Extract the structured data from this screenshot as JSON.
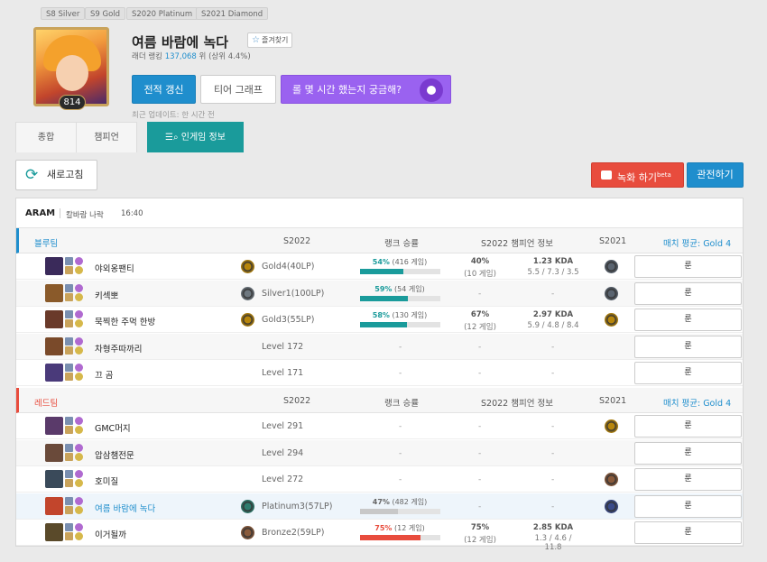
{
  "badges": [
    "S8 Silver",
    "S9 Gold",
    "S2020 Platinum",
    "S2021 Diamond"
  ],
  "profile": {
    "name": "여름 바람에 녹다",
    "favorite": "즐겨찾기",
    "level": "814",
    "ladder_prefix": "래더 랭킹",
    "ladder_rank": "137,068",
    "ladder_suffix": "위 (상위 4.4%)",
    "updated": "최근 업데이트: 한 시간 전"
  },
  "actions": {
    "refresh_record": "전적 갱신",
    "tier_graph": "티어 그래프",
    "promo": "롤 몇 시간 했는지 궁금해?"
  },
  "tabs": [
    "종합",
    "챔피언",
    "인게임 정보"
  ],
  "live": {
    "refresh": "새로고침",
    "record": "녹화 하기",
    "record_sup": "beta",
    "spectate": "관전하기",
    "mode": "ARAM",
    "map": "칼바람 나락",
    "duration": "16:40"
  },
  "columns": {
    "season": "S2022",
    "ranked_wr": "랭크 승률",
    "champ_info": "S2022 챔피언 정보",
    "s2021": "S2021"
  },
  "blue_team": {
    "name": "블루팀",
    "avg": "매치 평균: Gold 4",
    "players": [
      {
        "name": "야외옹팬티",
        "tier": "Gold4(40LP)",
        "tier_color": "#b8860b",
        "wr_pct": "54%",
        "wr_games": "(416 게임)",
        "wr_value": 54,
        "wr_color": "blue",
        "champ_wr": "40%",
        "champ_games": "(10 게임)",
        "kda": "1.23 KDA",
        "kda_detail": "5.5 / 7.3 / 3.5",
        "s21_color": "#5a6470",
        "rune": "룬",
        "champ_color": "#3a2a5a"
      },
      {
        "name": "키섹뽀",
        "tier": "Silver1(100LP)",
        "tier_color": "#6e7880",
        "wr_pct": "59%",
        "wr_games": "(54 게임)",
        "wr_value": 59,
        "wr_color": "blue",
        "champ_wr": "",
        "champ_games": "",
        "kda": "",
        "kda_detail": "",
        "s21_color": "#5a6470",
        "rune": "룬",
        "champ_color": "#8a5a2a"
      },
      {
        "name": "묵찍한 주먹 한방",
        "tier": "Gold3(55LP)",
        "tier_color": "#b8860b",
        "wr_pct": "58%",
        "wr_games": "(130 게임)",
        "wr_value": 58,
        "wr_color": "blue",
        "champ_wr": "67%",
        "champ_games": "(12 게임)",
        "kda": "2.97 KDA",
        "kda_detail": "5.9 / 4.8 / 8.4",
        "s21_color": "#b8860b",
        "rune": "룬",
        "champ_color": "#6a3a2a"
      },
      {
        "name": "차형주따까리",
        "tier": "Level 172",
        "tier_color": "",
        "wr_pct": "",
        "wr_games": "",
        "wr_value": 0,
        "wr_color": "",
        "champ_wr": "",
        "champ_games": "",
        "kda": "",
        "kda_detail": "",
        "s21_color": "",
        "rune": "룬",
        "champ_color": "#7a4a2a"
      },
      {
        "name": "끄 곰",
        "tier": "Level 171",
        "tier_color": "",
        "wr_pct": "",
        "wr_games": "",
        "wr_value": 0,
        "wr_color": "",
        "champ_wr": "",
        "champ_games": "",
        "kda": "",
        "kda_detail": "",
        "s21_color": "",
        "rune": "룬",
        "champ_color": "#4a3a7a"
      }
    ]
  },
  "red_team": {
    "name": "레드팀",
    "avg": "매치 평균: Gold 4",
    "players": [
      {
        "name": "GMC머지",
        "tier": "Level 291",
        "tier_color": "",
        "wr_pct": "",
        "wr_games": "",
        "wr_value": 0,
        "wr_color": "",
        "champ_wr": "",
        "champ_games": "",
        "kda": "",
        "kda_detail": "",
        "s21_color": "#b8860b",
        "rune": "룬",
        "champ_color": "#5a3a6a"
      },
      {
        "name": "압삼챔전문",
        "tier": "Level 294",
        "tier_color": "",
        "wr_pct": "",
        "wr_games": "",
        "wr_value": 0,
        "wr_color": "",
        "champ_wr": "",
        "champ_games": "",
        "kda": "",
        "kda_detail": "",
        "s21_color": "",
        "rune": "룬",
        "champ_color": "#6a4a3a"
      },
      {
        "name": "호미질",
        "tier": "Level 272",
        "tier_color": "",
        "wr_pct": "",
        "wr_games": "",
        "wr_value": 0,
        "wr_color": "",
        "champ_wr": "",
        "champ_games": "",
        "kda": "",
        "kda_detail": "",
        "s21_color": "#8a5a3a",
        "rune": "룬",
        "champ_color": "#3a4a5a"
      },
      {
        "name": "여름 바람에 녹다",
        "tier": "Platinum3(57LP)",
        "tier_color": "#2e7d6e",
        "wr_pct": "47%",
        "wr_games": "(482 게임)",
        "wr_value": 47,
        "wr_color": "gray",
        "champ_wr": "",
        "champ_games": "",
        "kda": "",
        "kda_detail": "",
        "s21_color": "#3a4a8a",
        "rune": "룬",
        "champ_color": "#c2452c",
        "me": true
      },
      {
        "name": "이거될까",
        "tier": "Bronze2(59LP)",
        "tier_color": "#8a5a3a",
        "wr_pct": "75%",
        "wr_games": "(12 게임)",
        "wr_value": 75,
        "wr_color": "red",
        "champ_wr": "75%",
        "champ_games": "(12 게임)",
        "kda": "2.85 KDA",
        "kda_detail": "1.3 / 4.6 / 11.8",
        "s21_color": "",
        "rune": "룬",
        "champ_color": "#5a4a2a"
      }
    ]
  },
  "dash": "-"
}
